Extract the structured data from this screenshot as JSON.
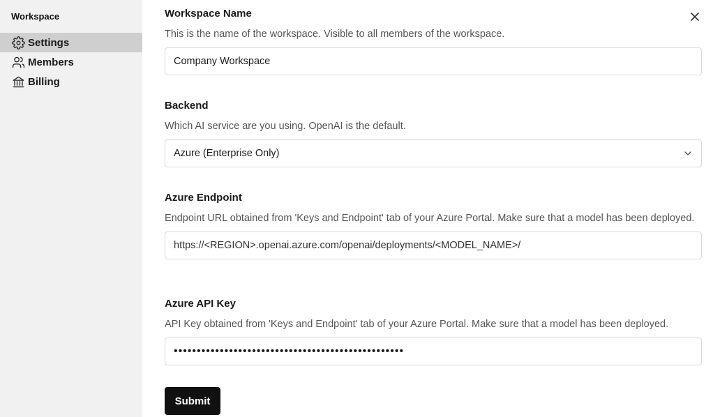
{
  "sidebar": {
    "title": "Workspace",
    "items": [
      {
        "label": "Settings",
        "icon": "gear-icon",
        "active": true
      },
      {
        "label": "Members",
        "icon": "users-icon",
        "active": false
      },
      {
        "label": "Billing",
        "icon": "bank-icon",
        "active": false
      }
    ]
  },
  "form": {
    "workspace_name": {
      "label": "Workspace Name",
      "description": "This is the name of the workspace. Visible to all members of the workspace.",
      "value": "Company Workspace"
    },
    "backend": {
      "label": "Backend",
      "description": "Which AI service are you using. OpenAI is the default.",
      "value": "Azure (Enterprise Only)"
    },
    "azure_endpoint": {
      "label": "Azure Endpoint",
      "description": "Endpoint URL obtained from 'Keys and Endpoint' tab of your Azure Portal. Make sure that a model has been deployed.",
      "value": "https://<REGION>.openai.azure.com/openai/deployments/<MODEL_NAME>/"
    },
    "azure_api_key": {
      "label": "Azure API Key",
      "description": "API Key obtained from 'Keys and Endpoint' tab of your Azure Portal. Make sure that a model has been deployed.",
      "value": "••••••••••••••••••••••••••••••••••••••••••••••••••"
    },
    "submit_label": "Submit"
  },
  "colors": {
    "sidebar_bg": "#f1f1f1",
    "active_item_bg": "#cfcfcf",
    "button_bg": "#111111"
  }
}
